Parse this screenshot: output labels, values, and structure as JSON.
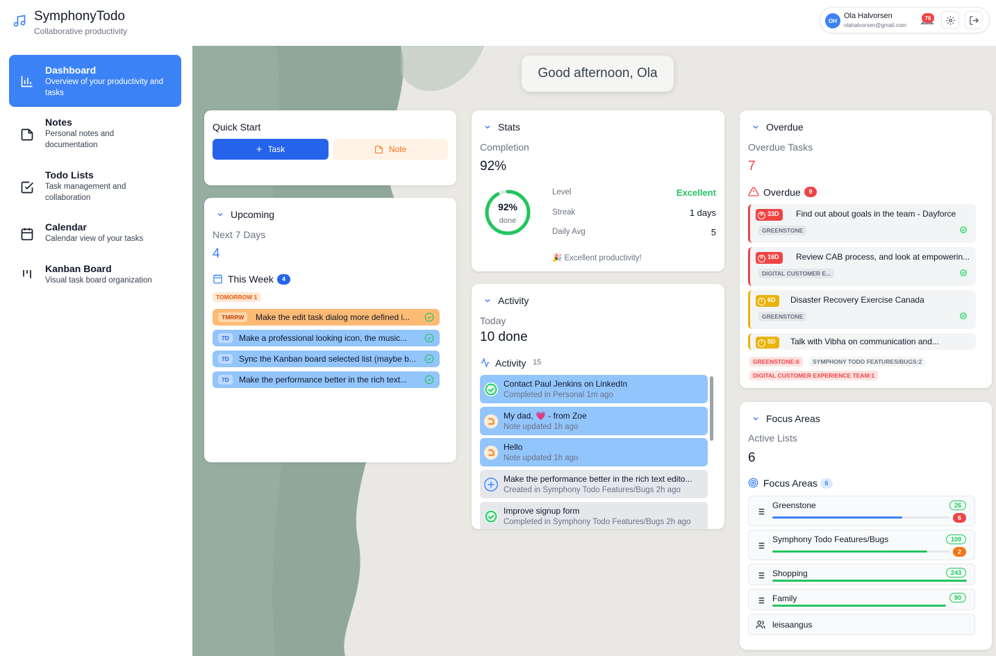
{
  "app": {
    "title": "SymphonyTodo",
    "subtitle": "Collaborative productivity"
  },
  "user": {
    "initials": "OH",
    "name": "Ola Halvorsen",
    "email": "olahalvorsen@gmail.com",
    "notifications": "76"
  },
  "sidebar": {
    "items": [
      {
        "title": "Dashboard",
        "sub": "Overview of your productivity and tasks"
      },
      {
        "title": "Notes",
        "sub": "Personal notes and documentation"
      },
      {
        "title": "Todo Lists",
        "sub": "Task management and collaboration"
      },
      {
        "title": "Calendar",
        "sub": "Calendar view of your tasks"
      },
      {
        "title": "Kanban Board",
        "sub": "Visual task board organization"
      }
    ]
  },
  "greeting": "Good afternoon, Ola",
  "quickstart": {
    "title": "Quick Start",
    "task": "Task",
    "note": "Note"
  },
  "upcoming": {
    "title": "Upcoming",
    "label": "Next 7 Days",
    "count": "4",
    "week_label": "This Week",
    "week_count": "4",
    "tomorrow_tag": "TOMORROW 1",
    "items": [
      {
        "tag": "TMRRW",
        "text": "Make the edit task dialog more defined i..."
      },
      {
        "tag": "7D",
        "text": "Make a professional looking icon, the music..."
      },
      {
        "tag": "7D",
        "text": "Sync the Kanban board selected list (maybe b..."
      },
      {
        "tag": "7D",
        "text": "Make the performance better in the rich text..."
      }
    ]
  },
  "stats": {
    "title": "Stats",
    "label": "Completion",
    "value": "92%",
    "ring_value": "92%",
    "ring_label": "done",
    "completion_fraction": 0.92,
    "level_label": "Level",
    "level": "Excellent",
    "streak_label": "Streak",
    "streak": "1 days",
    "avg_label": "Daily Avg",
    "avg": "5",
    "footer": "🎉 Excellent productivity!"
  },
  "activity": {
    "title": "Activity",
    "label": "Today",
    "value": "10 done",
    "list_label": "Activity",
    "list_count": "15",
    "items": [
      {
        "title": "Contact Paul Jenkins on LinkedIn",
        "sub": "Completed in Personal   1m ago",
        "kind": "done"
      },
      {
        "title": "My dad, 💗 - from Zoe",
        "sub": "Note updated   1h ago",
        "kind": "note"
      },
      {
        "title": "Hello",
        "sub": "Note updated   1h ago",
        "kind": "note"
      },
      {
        "title": "Make the performance better in the rich text edito...",
        "sub": "Created in Symphony Todo Features/Bugs   2h ago",
        "kind": "new"
      },
      {
        "title": "Improve signup form",
        "sub": "Completed in Symphony Todo Features/Bugs   2h ago",
        "kind": "done"
      }
    ]
  },
  "overdue": {
    "title": "Overdue",
    "label": "Overdue Tasks",
    "count": "7",
    "list_label": "Overdue",
    "list_count": "9",
    "items": [
      {
        "tag": "33D",
        "text": "Find out about goals in the team - Dayforce",
        "list": "GREENSTONE",
        "sev": "red"
      },
      {
        "tag": "16D",
        "text": "Review CAB process, and look at empowerin...",
        "list": "DIGITAL CUSTOMER E...",
        "sev": "red"
      },
      {
        "tag": "6D",
        "text": "Disaster Recovery Exercise Canada",
        "list": "GREENSTONE",
        "sev": "amber"
      },
      {
        "tag": "5D",
        "text": "Talk with Vibha on communication and...",
        "list": "",
        "sev": "amber"
      }
    ],
    "summary": [
      "GREENSTONE:6",
      "SYMPHONY TODO FEATURES/BUGS:2",
      "DIGITAL CUSTOMER EXPERIENCE TEAM:1"
    ]
  },
  "focus": {
    "title": "Focus Areas",
    "label": "Active Lists",
    "count": "6",
    "list_label": "Focus Areas",
    "list_count": "6",
    "items": [
      {
        "name": "Greenstone",
        "done": "26",
        "overdue": "6",
        "progress": 0.73
      },
      {
        "name": "Symphony Todo Features/Bugs",
        "done": "109",
        "overdue": "2",
        "progress": 0.87
      },
      {
        "name": "Shopping",
        "done": "243",
        "overdue": "",
        "progress": 1.0
      },
      {
        "name": "Family",
        "done": "80",
        "overdue": "",
        "progress": 1.0
      },
      {
        "name": "leisaangus",
        "done": "",
        "overdue": "",
        "progress": 0
      }
    ]
  },
  "colors": {
    "primary": "#3b82f6",
    "danger": "#ef4444",
    "success": "#22c55e",
    "warning": "#f59e0b"
  }
}
